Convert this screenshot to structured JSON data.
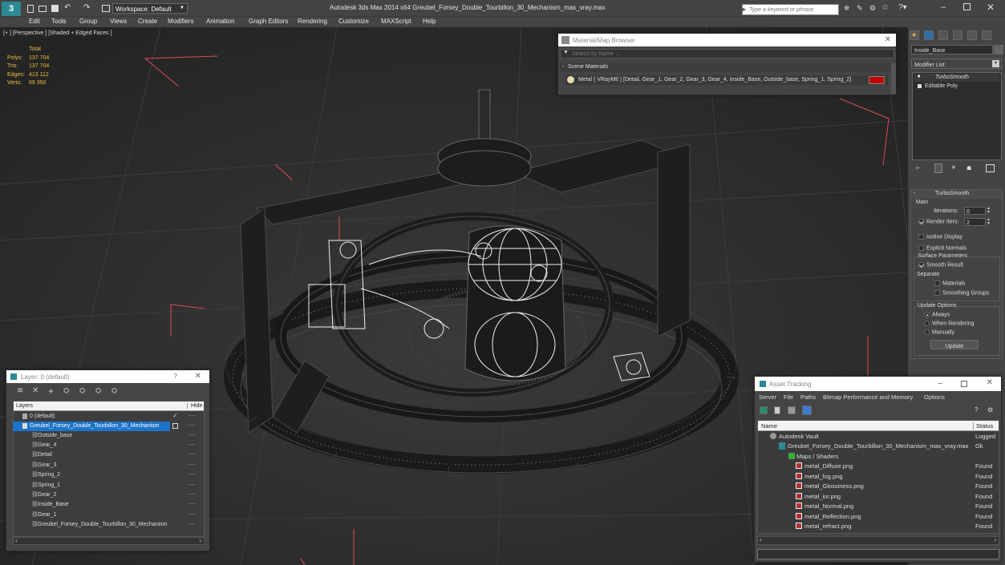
{
  "app": {
    "title": "Autodesk 3ds Max  2014 x64     Greubel_Forsey_Double_Tourbillon_30_Mechanism_max_vray.max",
    "workspace": "Workspace: Default",
    "search_placeholder": "Type a keyword or phrase",
    "menu": [
      "Edit",
      "Tools",
      "Group",
      "Views",
      "Create",
      "Modifiers",
      "Animation",
      "Graph Editors",
      "Rendering",
      "Customize",
      "MAXScript",
      "Help"
    ]
  },
  "viewport": {
    "label": "[+ ] [Perspective ] [Shaded + Edged Faces ]",
    "stats": {
      "total_label": "Total",
      "rows": [
        {
          "label": "Polys:",
          "value": "137 704"
        },
        {
          "label": "Tris:",
          "value": "137 704"
        },
        {
          "label": "Edges:",
          "value": "413 112"
        },
        {
          "label": "Verts:",
          "value": "69 350"
        }
      ]
    }
  },
  "material_browser": {
    "title": "Material/Map Browser",
    "search_placeholder": "Search by Name ...",
    "section": "Scene Materials",
    "material": "Metal  ( VRayMtl ) [Detail, Gear_1, Gear_2, Gear_3, Gear_4, Inside_Base, Outside_base, Spring_1, Spring_2]",
    "swatch_color": "#c00000"
  },
  "command_panel": {
    "object_name": "Inside_Base",
    "modifier_list": "Modifier List",
    "stack": [
      "TurboSmooth",
      "Editable Poly"
    ],
    "rollout_title": "TurboSmooth",
    "main_label": "Main",
    "iterations_label": "Iterations:",
    "iterations_value": "0",
    "render_iters_label": "Render Iters:",
    "render_iters_value": "2",
    "isoline": "Isoline Display",
    "explicit_normals": "Explicit Normals",
    "surface_params": "Surface Parameters",
    "smooth_result": "Smooth Result",
    "separate": "Separate",
    "materials": "Materials",
    "smoothing_groups": "Smoothing Groups",
    "update_options": "Update Options",
    "always": "Always",
    "when_rendering": "When Rendering",
    "manually": "Manually",
    "update_button": "Update"
  },
  "layer_window": {
    "title": "Layer: 0 (default)",
    "help": "?",
    "col_layers": "Layers",
    "col_hide": "Hide",
    "hide_marker": "----",
    "rows": [
      "0 (default)",
      "Greubel_Forsey_Double_Tourbillon_30_Mechanism",
      "Outside_base",
      "Gear_4",
      "Detail",
      "Gear_3",
      "Spring_2",
      "Spring_1",
      "Gear_2",
      "Inside_Base",
      "Gear_1",
      "Greubel_Forsey_Double_Tourbillon_30_Mechanism"
    ]
  },
  "asset_tracking": {
    "title": "Asset Tracking",
    "menu": [
      "Server",
      "File",
      "Paths",
      "Bitmap Performance and Memory",
      "Options"
    ],
    "col_name": "Name",
    "col_status": "Status",
    "rows": [
      {
        "name": "Autodesk Vault",
        "status": "Logged"
      },
      {
        "name": "Greubel_Forsey_Double_Tourbillon_30_Mechanism_max_vray.max",
        "status": "Ok"
      },
      {
        "name": "Maps / Shaders",
        "status": ""
      },
      {
        "name": "metal_Diffuse.png",
        "status": "Found"
      },
      {
        "name": "metal_fog.png",
        "status": "Found"
      },
      {
        "name": "metal_Glossiness.png",
        "status": "Found"
      },
      {
        "name": "metal_ior.png",
        "status": "Found"
      },
      {
        "name": "metal_Normal.png",
        "status": "Found"
      },
      {
        "name": "metal_Reflection.png",
        "status": "Found"
      },
      {
        "name": "metal_refract.png",
        "status": "Found"
      }
    ]
  }
}
